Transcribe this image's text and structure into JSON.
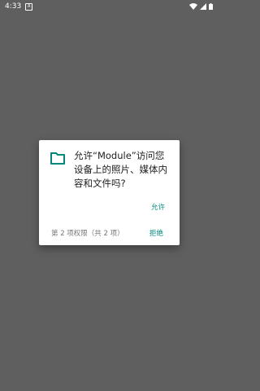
{
  "status_bar": {
    "time": "4:33",
    "notification_icon": "A"
  },
  "dialog": {
    "icon": "folder-icon",
    "message": "允许“Module”访问您设备上的照片、媒体内容和文件吗?",
    "allow_label": "允许",
    "deny_label": "拒绝",
    "permission_counter": "第 2 项权限（共 2 项）"
  },
  "colors": {
    "accent": "#00897b",
    "scrim": "#5f5f5f",
    "text": "#212121"
  }
}
